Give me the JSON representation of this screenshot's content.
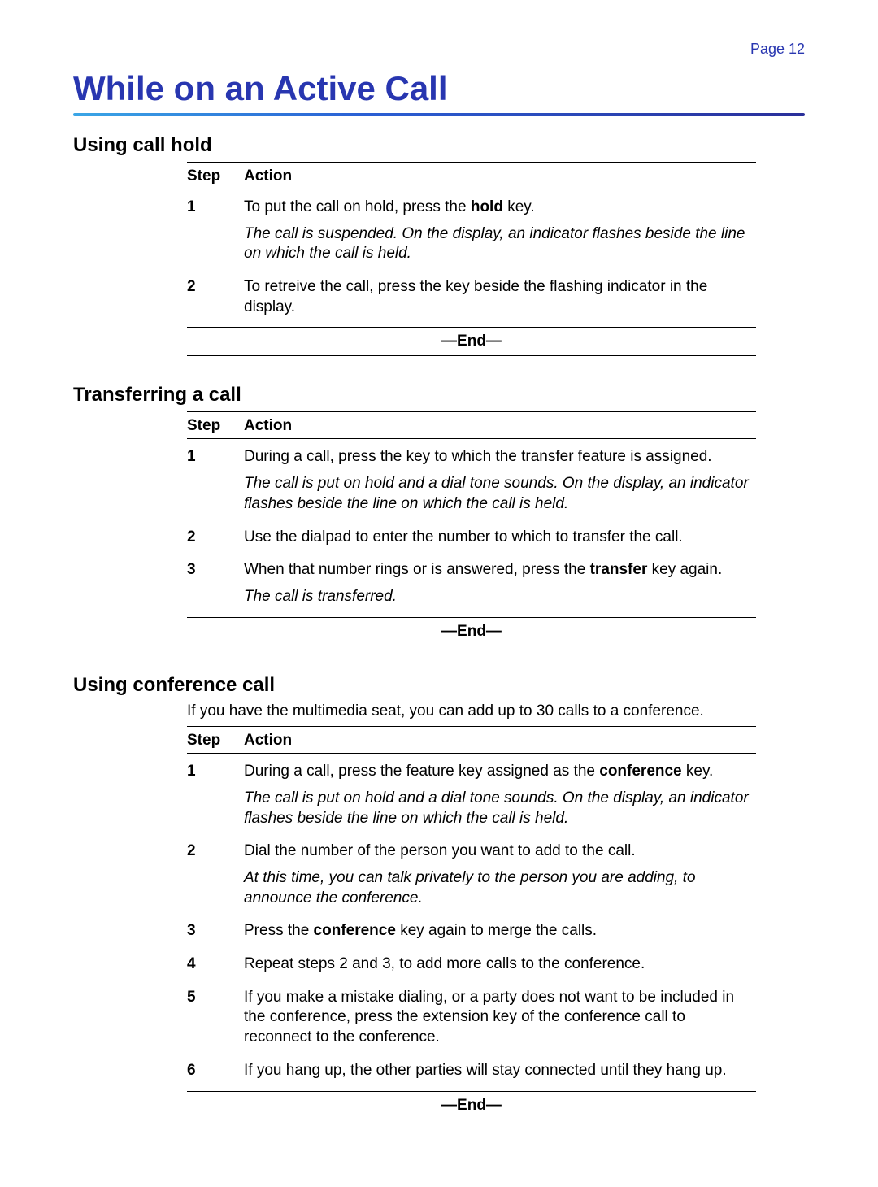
{
  "page_number_label": "Page 12",
  "title": "While on an Active Call",
  "header_step": "Step",
  "header_action": "Action",
  "end_label": "—End—",
  "sections": [
    {
      "heading": "Using call hold",
      "intro": "",
      "steps": [
        {
          "num": "1",
          "action_pre": "To put the call on hold, press the ",
          "action_bold": "hold",
          "action_post": " key.",
          "note": "The call is suspended. On the display, an indicator flashes beside the line on which the call is held."
        },
        {
          "num": "2",
          "action_pre": "To retreive the call, press the key beside the flashing indicator in the display.",
          "action_bold": "",
          "action_post": "",
          "note": ""
        }
      ]
    },
    {
      "heading": "Transferring a call",
      "intro": "",
      "steps": [
        {
          "num": "1",
          "action_pre": "During a call, press the key to which the transfer feature is assigned.",
          "action_bold": "",
          "action_post": "",
          "note": "The call is put on hold and a dial tone sounds. On the display, an indicator flashes beside the line on which the call is held."
        },
        {
          "num": "2",
          "action_pre": "Use the dialpad to enter the number to which to transfer the call.",
          "action_bold": "",
          "action_post": "",
          "note": ""
        },
        {
          "num": "3",
          "action_pre": "When that number rings or is answered, press the ",
          "action_bold": "transfer",
          "action_post": " key again.",
          "note": "The call is transferred."
        }
      ]
    },
    {
      "heading": "Using conference call",
      "intro": "If you have the multimedia seat, you can add up to 30 calls to a conference.",
      "steps": [
        {
          "num": "1",
          "action_pre": "During a call, press the feature key assigned as the ",
          "action_bold": "conference",
          "action_post": " key.",
          "note": "The call is put on hold and a dial tone sounds. On the display, an indicator flashes beside the line on which the call is held."
        },
        {
          "num": "2",
          "action_pre": "Dial the number of the person you want to add to the call.",
          "action_bold": "",
          "action_post": "",
          "note": "At this time, you can talk privately to the person you are adding, to announce the conference."
        },
        {
          "num": "3",
          "action_pre": "Press the ",
          "action_bold": "conference",
          "action_post": " key again to merge the calls.",
          "note": ""
        },
        {
          "num": "4",
          "action_pre": "Repeat steps 2 and 3, to add more calls to the conference.",
          "action_bold": "",
          "action_post": "",
          "note": ""
        },
        {
          "num": "5",
          "action_pre": "If you make a mistake dialing, or a party does not want to be included in the conference, press the extension key of the conference call to reconnect to the conference.",
          "action_bold": "",
          "action_post": "",
          "note": ""
        },
        {
          "num": "6",
          "action_pre": "If you hang up, the other parties will stay connected until they hang up.",
          "action_bold": "",
          "action_post": "",
          "note": ""
        }
      ]
    }
  ]
}
